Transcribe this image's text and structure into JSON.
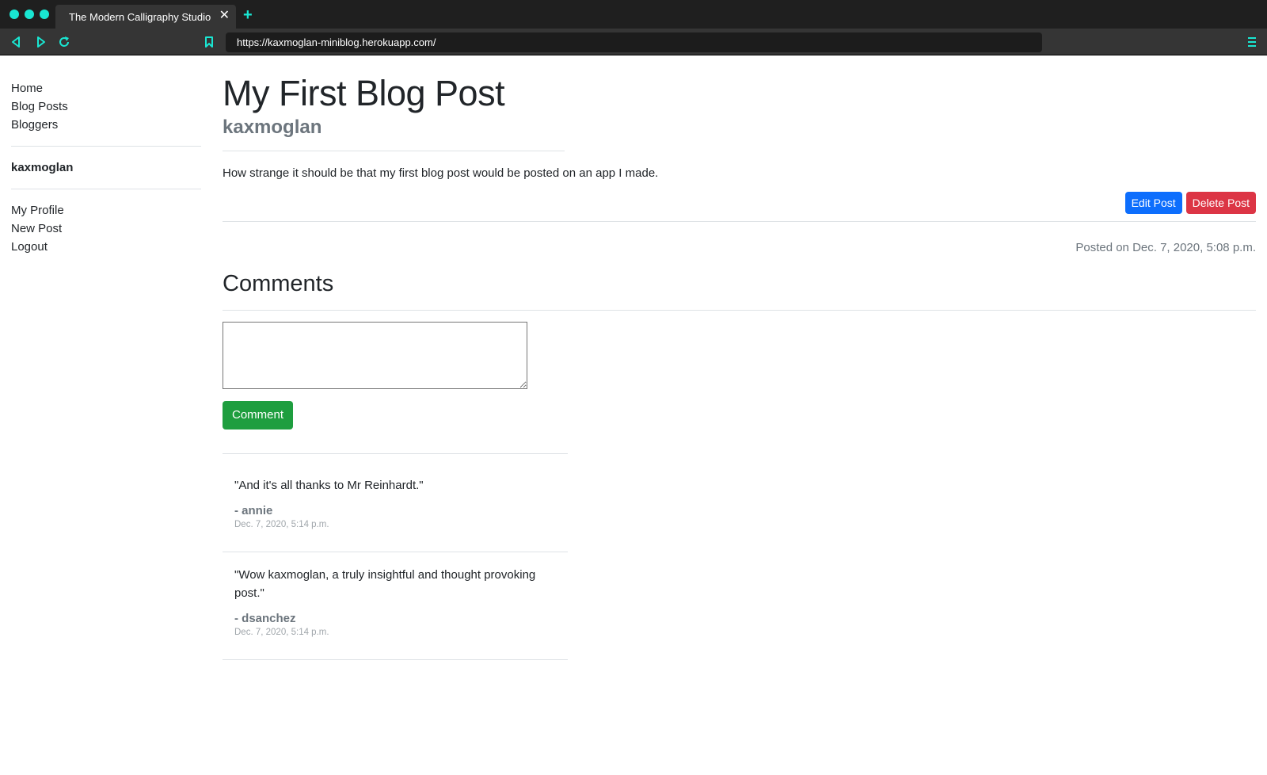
{
  "browser": {
    "tab_title": "The Modern Calligraphy Studio",
    "tab_close": "✕",
    "new_tab": "+",
    "url": "https://kaxmoglan-miniblog.herokuapp.com/",
    "accent_color": "#19e6d2"
  },
  "sidebar": {
    "nav": [
      "Home",
      "Blog Posts",
      "Bloggers"
    ],
    "username": "kaxmoglan",
    "account": [
      "My Profile",
      "New Post",
      "Logout"
    ]
  },
  "post": {
    "title": "My First Blog Post",
    "author": "kaxmoglan",
    "body": "How strange it should be that my first blog post would be posted on an app I made.",
    "edit_label": "Edit Post",
    "delete_label": "Delete Post",
    "posted_on": "Posted on Dec. 7, 2020, 5:08 p.m."
  },
  "comments": {
    "heading": "Comments",
    "input_value": "",
    "submit_label": "Comment",
    "items": [
      {
        "text": "\"And it's all thanks to Mr Reinhardt.\"",
        "author": "- annie",
        "date": "Dec. 7, 2020, 5:14 p.m."
      },
      {
        "text": "\"Wow kaxmoglan, a truly insightful and thought provoking post.\"",
        "author": "- dsanchez",
        "date": "Dec. 7, 2020, 5:14 p.m."
      }
    ]
  },
  "colors": {
    "edit_button": "#0d6efd",
    "delete_button": "#dc3545",
    "comment_button": "#1e9e3f"
  }
}
